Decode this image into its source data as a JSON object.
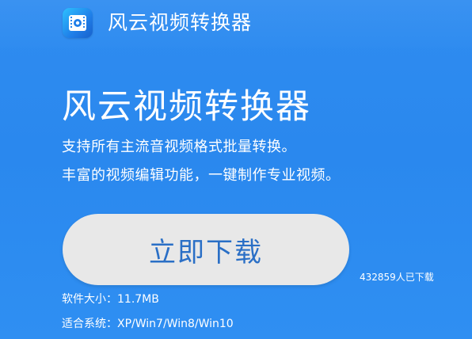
{
  "header": {
    "app_name": "风云视频转换器",
    "logo_icon": "video-film-icon"
  },
  "hero": {
    "title": "风云视频转换器",
    "tagline_1": "支持所有主流音视频格式批量转换。",
    "tagline_2": "丰富的视频编辑功能，一键制作专业视频。"
  },
  "download": {
    "button_label": "立即下载",
    "count_text": "432859人已下载"
  },
  "info": {
    "size_text": "软件大小：11.7MB",
    "systems_text": "适合系统：XP/Win7/Win8/Win10"
  },
  "colors": {
    "background": "#2f8cf0",
    "button_bg": "#e8e8e8",
    "button_text": "#2a6fc6"
  }
}
